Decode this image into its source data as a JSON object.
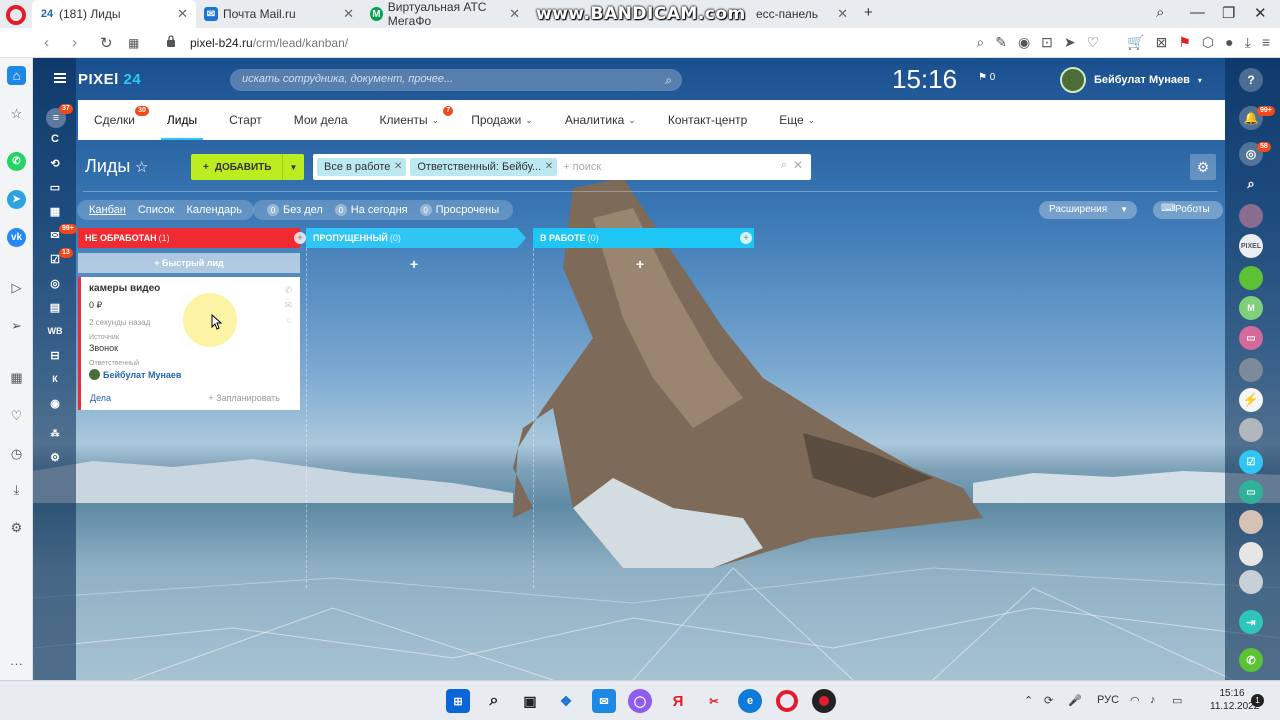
{
  "browser": {
    "tabs": [
      {
        "label": "(181) Лиды",
        "favicon": "24"
      },
      {
        "label": "Почта Mail.ru",
        "favicon": "✉"
      },
      {
        "label": "Виртуальная АТС МегаФо",
        "favicon": "М"
      },
      {
        "label": "есс-панель",
        "favicon": ""
      }
    ],
    "watermark": "www.BANDICAM.com",
    "url_host": "pixel-b24.ru",
    "url_path": "/crm/lead/kanban/"
  },
  "app": {
    "brand_name": "PIXEl",
    "brand_num": "24",
    "search_placeholder": "искать сотрудника, документ, прочее...",
    "clock": "15:16",
    "flag_count": "0",
    "user_name": "Бейбулат Мунаев",
    "left_badges": {
      "top": "37",
      "mail": "99+",
      "tasks": "13"
    },
    "left_letters": {
      "c": "С",
      "wb": "WB",
      "k": "К"
    },
    "right_badges": {
      "notify": "99+",
      "chat": "58"
    },
    "right_letters": {
      "pixel": "PIXEL",
      "m": "М"
    }
  },
  "menu": [
    {
      "label": "Сделки",
      "badge": "30"
    },
    {
      "label": "Лиды",
      "badge": ""
    },
    {
      "label": "Старт",
      "badge": ""
    },
    {
      "label": "Мои дела",
      "badge": ""
    },
    {
      "label": "Клиенты",
      "badge": "7",
      "caret": "⌄"
    },
    {
      "label": "Продажи",
      "badge": "",
      "caret": "⌄"
    },
    {
      "label": "Аналитика",
      "badge": "",
      "caret": "⌄"
    },
    {
      "label": "Контакт-центр",
      "badge": ""
    },
    {
      "label": "Еще",
      "badge": "",
      "caret": "⌄"
    }
  ],
  "page": {
    "title": "Лиды",
    "add_label": "ДОБАВИТЬ",
    "filter_chips": [
      "Все в работе",
      "Ответственный: Бейбу..."
    ],
    "filter_placeholder": "+ поиск",
    "views": [
      "Канбан",
      "Список",
      "Календарь"
    ],
    "counters": [
      {
        "n": "0",
        "label": "Без дел"
      },
      {
        "n": "0",
        "label": "На сегодня"
      },
      {
        "n": "0",
        "label": "Просрочены"
      }
    ],
    "extensions_label": "Расширения",
    "robots_label": "Роботы"
  },
  "kanban": {
    "columns": [
      {
        "title": "НЕ ОБРАБОТАН",
        "count": "(1)",
        "color": "#f02a31"
      },
      {
        "title": "ПРОПУЩЕННЫЙ",
        "count": "(0)",
        "color": "#2fc6f6"
      },
      {
        "title": "В РАБОТЕ",
        "count": "(0)",
        "color": "#1ec7f3"
      }
    ],
    "quick_lead": "+ Быстрый лид",
    "card": {
      "title": "камеры видео",
      "sum": "0 ₽",
      "ago": "2 секунды назад",
      "source_label": "Источник",
      "source_value": "Звонок",
      "responsible_label": "Ответственный",
      "responsible_value": "Бейбулат Мунаев",
      "deals": "Дела",
      "plan": "+ Запланировать"
    }
  },
  "taskbar": {
    "lang": "РУС",
    "time": "15:16",
    "date": "11.12.2022",
    "notif": "1"
  }
}
